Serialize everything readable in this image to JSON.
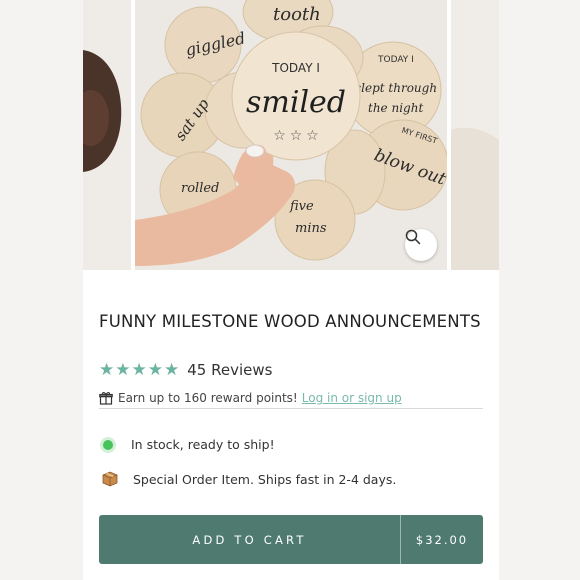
{
  "gallery": {
    "discs": {
      "today_i": "TODAY I",
      "smiled": "smiled",
      "giggled": "giggled",
      "tooth": "tooth",
      "slept": "slept through",
      "the_night": "the night",
      "sat_up": "sat up",
      "blow_out": "blow out",
      "my_first": "MY FIRST",
      "five_mins": "five",
      "mins": "mins",
      "rolled": "rolled"
    },
    "zoom_icon": "magnifier-icon"
  },
  "product": {
    "title": "FUNNY MILESTONE WOOD ANNOUNCEMENTS",
    "rating": 5,
    "reviews_label": "45 Reviews",
    "rewards_text": "Earn up to 160 reward points!",
    "rewards_link": "Log in or sign up",
    "stock_text": "In stock, ready to ship!",
    "special_text": "Special Order Item. Ships fast in 2-4 days.",
    "cart_label": "ADD TO CART",
    "price": "$32.00"
  },
  "colors": {
    "accent": "#6db3a3",
    "button": "#4e7a6f",
    "stock_dot": "#46c35b",
    "link": "#7ab9ad"
  }
}
